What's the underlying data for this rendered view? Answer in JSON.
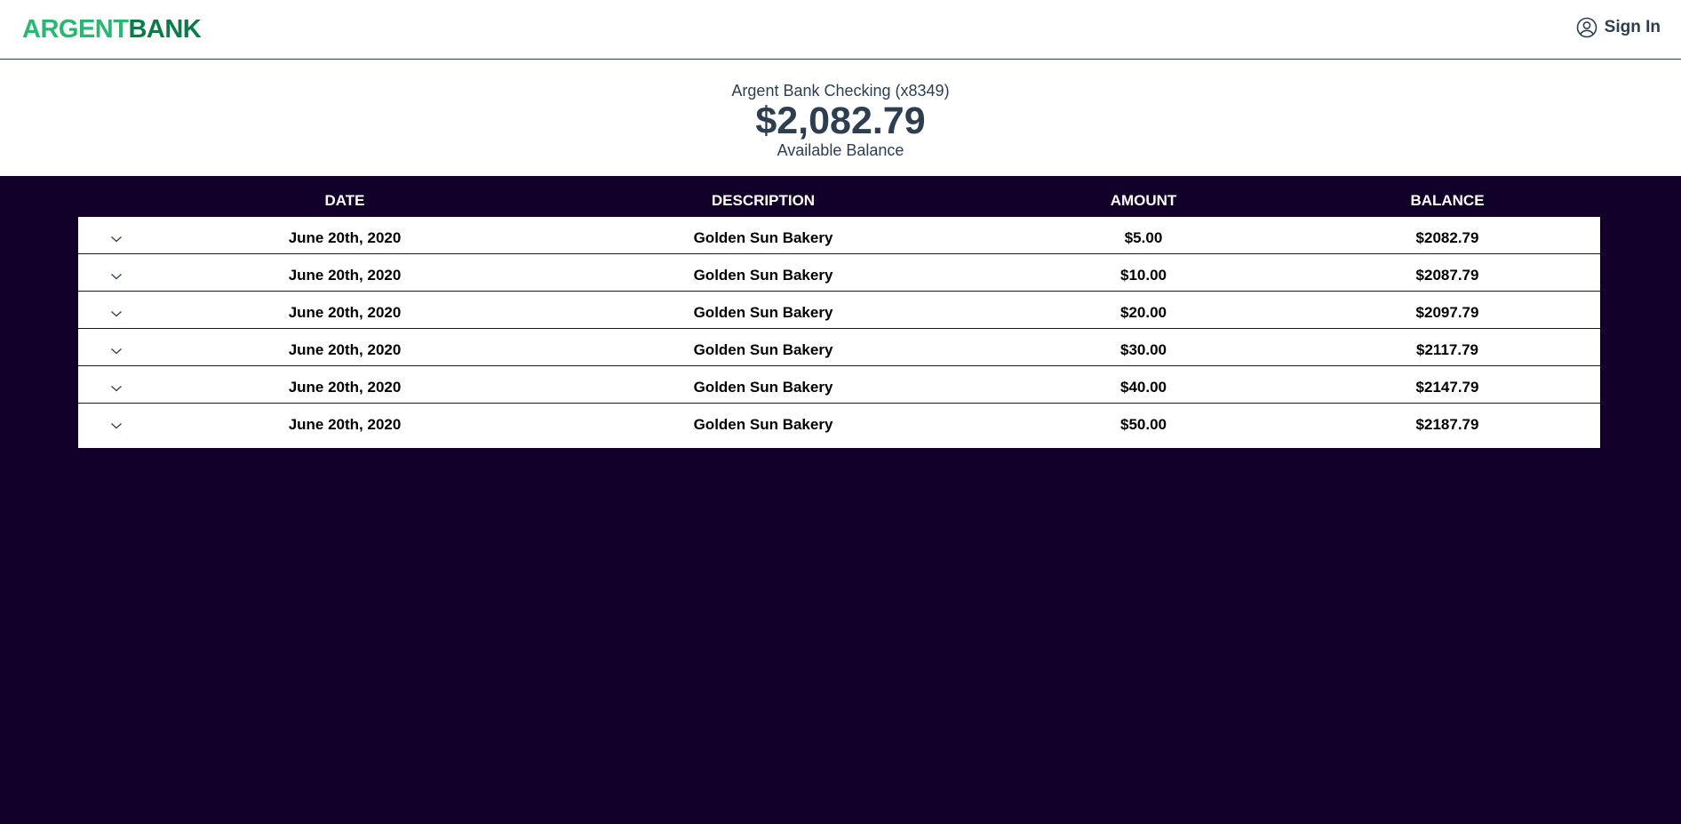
{
  "header": {
    "logo_part1": "ARGENT",
    "logo_part2": "BANK",
    "signin_label": "Sign In"
  },
  "account": {
    "name": "Argent Bank Checking (x8349)",
    "balance": "$2,082.79",
    "balance_label": "Available Balance"
  },
  "table": {
    "columns": [
      "DATE",
      "DESCRIPTION",
      "AMOUNT",
      "BALANCE"
    ],
    "rows": [
      {
        "date": "June 20th, 2020",
        "description": "Golden Sun Bakery",
        "amount": "$5.00",
        "balance": "$2082.79"
      },
      {
        "date": "June 20th, 2020",
        "description": "Golden Sun Bakery",
        "amount": "$10.00",
        "balance": "$2087.79"
      },
      {
        "date": "June 20th, 2020",
        "description": "Golden Sun Bakery",
        "amount": "$20.00",
        "balance": "$2097.79"
      },
      {
        "date": "June 20th, 2020",
        "description": "Golden Sun Bakery",
        "amount": "$30.00",
        "balance": "$2117.79"
      },
      {
        "date": "June 20th, 2020",
        "description": "Golden Sun Bakery",
        "amount": "$40.00",
        "balance": "$2147.79"
      },
      {
        "date": "June 20th, 2020",
        "description": "Golden Sun Bakery",
        "amount": "$50.00",
        "balance": "$2187.79"
      }
    ]
  },
  "icons": {
    "user": "user-circle-icon",
    "expand": "chevron-down-icon"
  },
  "colors": {
    "brand_light": "#2bb673",
    "brand_dark": "#0d7a4a",
    "text_dark": "#2c3e50",
    "page_bg": "#12002b"
  }
}
